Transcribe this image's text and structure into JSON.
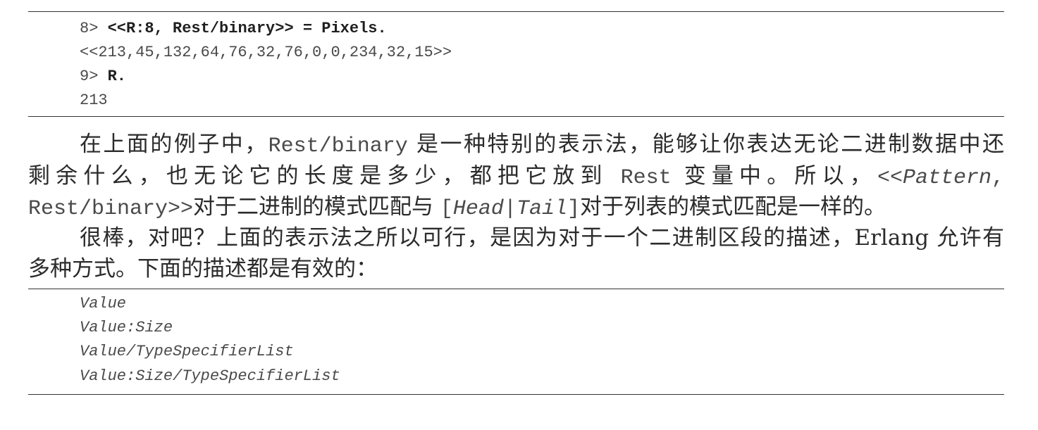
{
  "colors": {
    "text": "#2b2b2b",
    "code": "#4a4a4a",
    "rule": "#333333"
  },
  "code_block_1": {
    "lines": [
      {
        "prompt": "8> ",
        "input": "<<R:8, Rest/binary>> = Pixels."
      },
      {
        "output": "<<213,45,132,64,76,32,76,0,0,234,32,15>>"
      },
      {
        "prompt": "9> ",
        "input": "R."
      },
      {
        "output": "213"
      }
    ]
  },
  "paragraph_1": {
    "line_1": {
      "text_a": "在上面的例子中，",
      "code_a": "Rest/binary",
      "text_b": " 是一种特别的表示法，能够让你表达无论二进制数据中还"
    },
    "line_2": {
      "text_a": "剩余什么，也无论它的长度是多少，都把它放到 ",
      "code_a": "Rest",
      "text_b": " 变量中。所以，",
      "code_b": "<<",
      "code_italic": "Pattern",
      "code_c": ","
    },
    "line_3": {
      "code_a": "Rest/binary>>",
      "text_a": "对于二进制的模式匹配与 ",
      "code_b": "[",
      "code_italic_a": "Head",
      "code_c": "|",
      "code_italic_b": "Tail",
      "code_d": "]",
      "text_b": "对于列表的模式匹配是一样的。"
    }
  },
  "paragraph_2": {
    "line_1": "很棒，对吧？上面的表示法之所以可行，是因为对于一个二进制区段的描述，Erlang 允许有",
    "line_2": "多种方式。下面的描述都是有效的："
  },
  "code_block_2": {
    "lines": [
      "Value",
      "Value:Size",
      "Value/TypeSpecifierList",
      "Value:Size/TypeSpecifierList"
    ]
  }
}
